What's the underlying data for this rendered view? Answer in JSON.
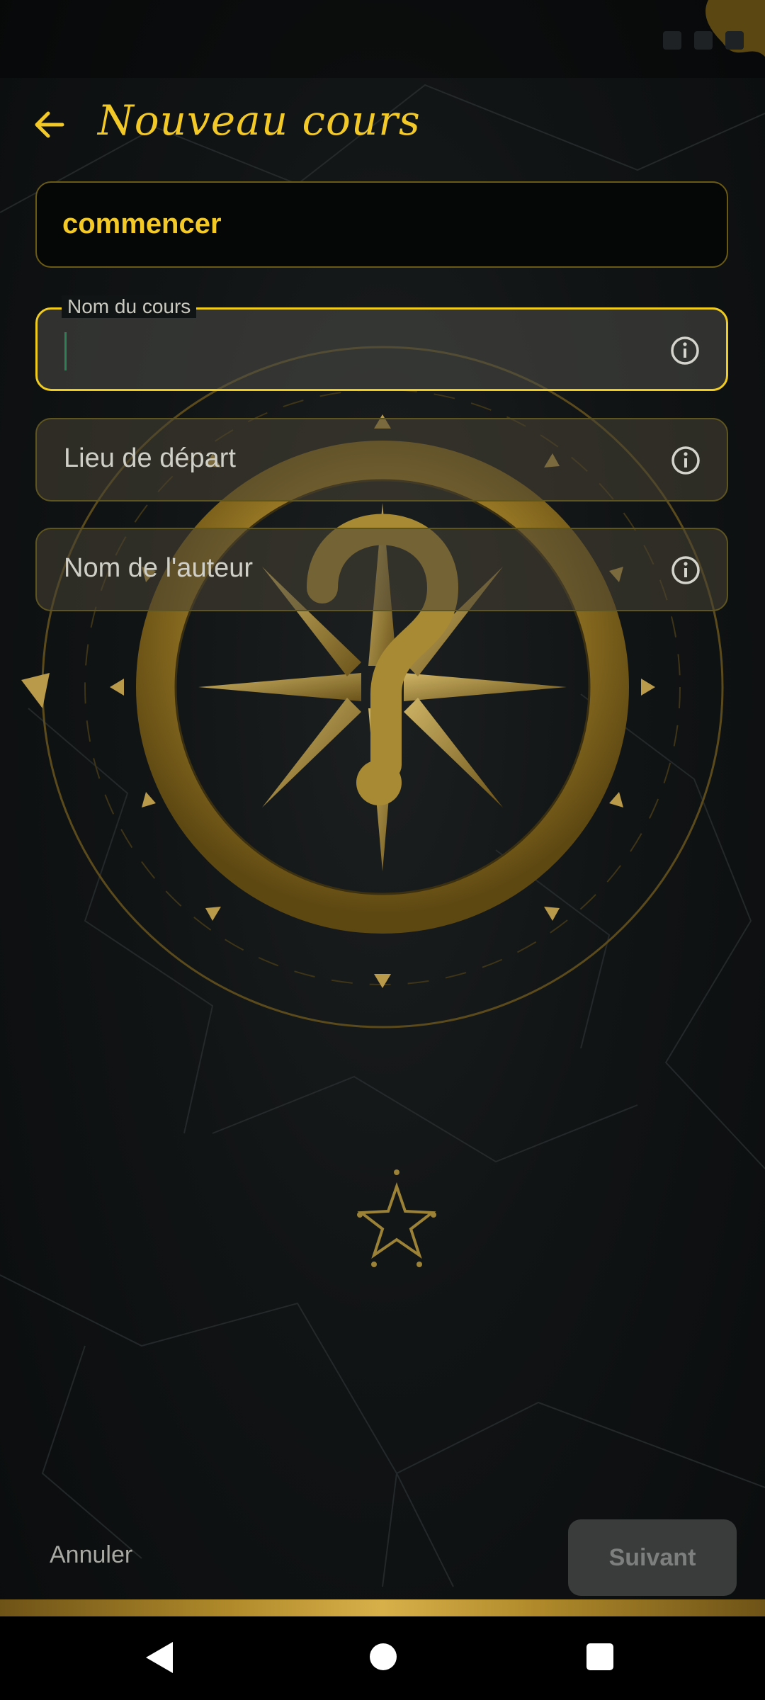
{
  "header": {
    "title": "Nouveau cours",
    "back_icon": "arrow-left-icon"
  },
  "form": {
    "type_value": "commencer",
    "course_name": {
      "label": "Nom du cours",
      "value": ""
    },
    "start_place": {
      "placeholder": "Lieu de départ"
    },
    "author_name": {
      "placeholder": "Nom de l'auteur"
    },
    "info_icon": "info-circle-icon"
  },
  "actions": {
    "cancel_label": "Annuler",
    "next_label": "Suivant"
  },
  "colors": {
    "accent": "#f3c928",
    "focused_border": "#f0cc21",
    "background": "#111415",
    "gold": "#b08a2a"
  }
}
